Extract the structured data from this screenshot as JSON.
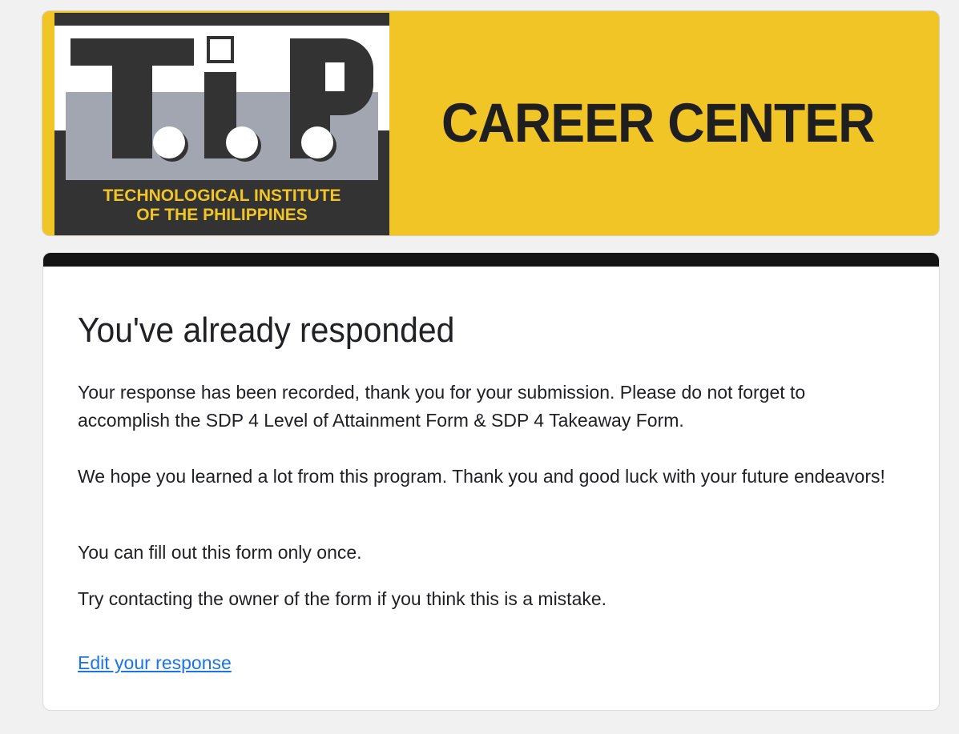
{
  "banner": {
    "logo_letters": "T.i.P.",
    "logo_line1": "TECHNOLOGICAL INSTITUTE",
    "logo_line2": "OF THE PHILIPPINES",
    "title": "CAREER CENTER",
    "colors": {
      "background": "#f2c526",
      "logo_dark": "#333333",
      "logo_gray": "#a2a6b1",
      "logo_text": "#f2c526"
    }
  },
  "card": {
    "heading": "You've already responded",
    "message_1": "Your response has been recorded, thank you for your submission. Please do not forget to accomplish the SDP 4 Level of Attainment Form & SDP 4 Takeaway Form.",
    "message_2": "We hope you learned a lot from this program. Thank you and good luck with your future endeavors!",
    "only_once": "You can fill out this form only once.",
    "contact_owner": "Try contacting the owner of the form if you think this is a mistake.",
    "edit_link": "Edit your response",
    "colors": {
      "top_bar": "#141414",
      "link": "#1a73e8"
    }
  }
}
